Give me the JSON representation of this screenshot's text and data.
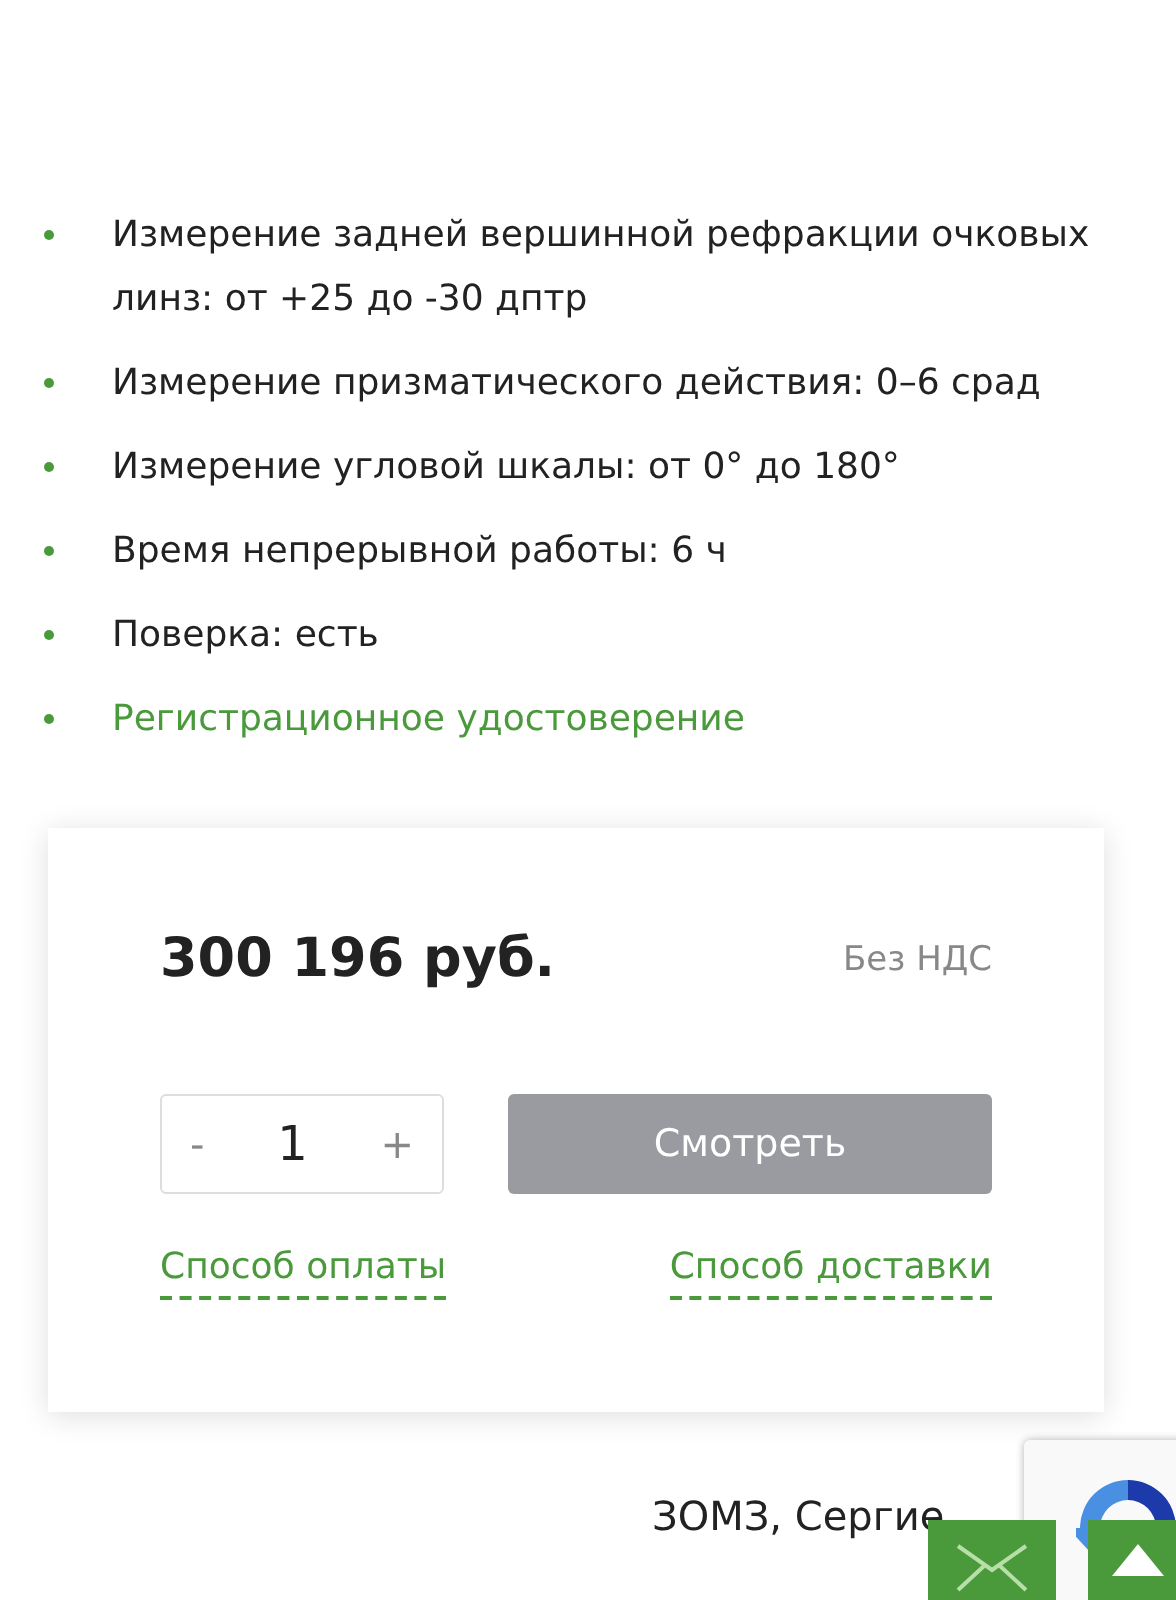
{
  "features": [
    {
      "kind": "text",
      "text": "Измерение задней вершинной рефракции очковых линз: от +25 до -30 дптр"
    },
    {
      "kind": "text",
      "text": "Измерение призматического действия: 0–6 срад"
    },
    {
      "kind": "text",
      "text": "Измерение угловой шкалы: от 0° до 180°"
    },
    {
      "kind": "text",
      "text": "Время непрерывной работы: 6 ч"
    },
    {
      "kind": "text",
      "text": "Поверка: есть"
    },
    {
      "kind": "link",
      "text": "Регистрационное удостоверение"
    }
  ],
  "price_card": {
    "price": "300 196 руб.",
    "vat": "Без НДС",
    "quantity": {
      "minus": "-",
      "value": "1",
      "plus": "+"
    },
    "button": "Смотреть",
    "links": [
      "Способ оплаты",
      "Способ доставки"
    ]
  },
  "footer_text": "ЗОМЗ, Сергие"
}
